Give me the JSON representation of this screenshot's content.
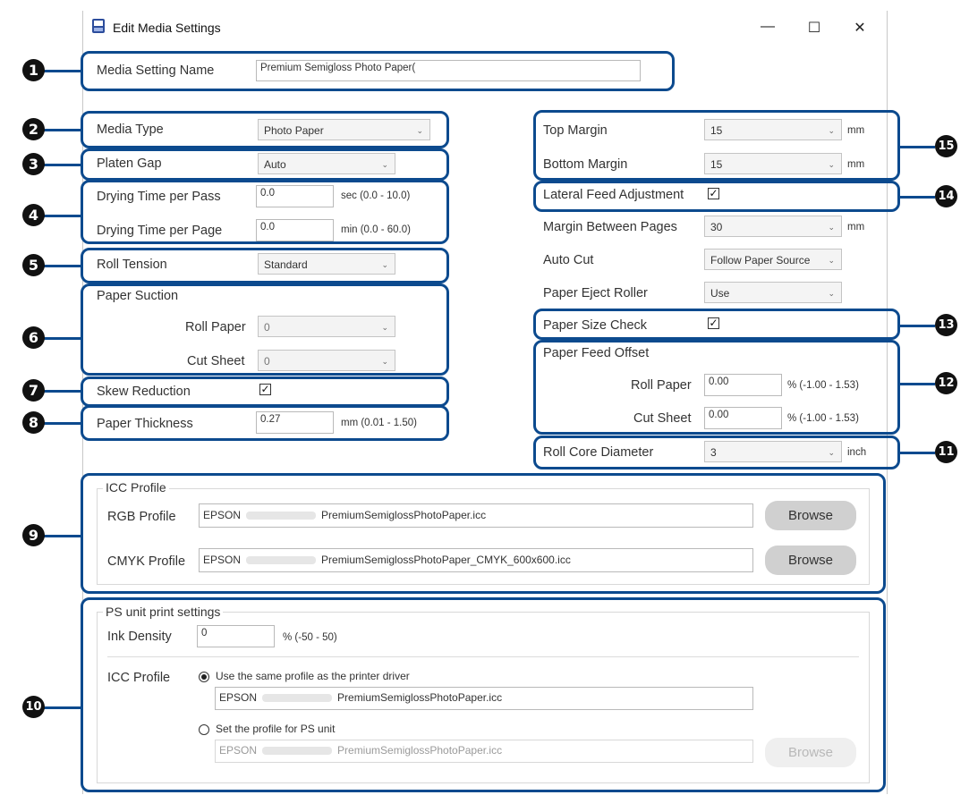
{
  "window": {
    "title": "Edit Media Settings",
    "minimize": "—",
    "maximize": "☐",
    "close": "✕"
  },
  "media_setting_name": {
    "label": "Media Setting Name",
    "value": "Premium Semigloss Photo Paper("
  },
  "media_type": {
    "label": "Media Type",
    "value": "Photo Paper"
  },
  "platen_gap": {
    "label": "Platen Gap",
    "value": "Auto"
  },
  "drying_pass": {
    "label": "Drying Time per Pass",
    "value": "0.0",
    "range": "sec (0.0 - 10.0)"
  },
  "drying_page": {
    "label": "Drying Time per Page",
    "value": "0.0",
    "range": "min (0.0 - 60.0)"
  },
  "roll_tension": {
    "label": "Roll Tension",
    "value": "Standard"
  },
  "paper_suction": {
    "title": "Paper Suction",
    "roll_label": "Roll Paper",
    "roll_value": "0",
    "cut_label": "Cut Sheet",
    "cut_value": "0"
  },
  "skew_reduction": {
    "label": "Skew Reduction",
    "checked": true
  },
  "paper_thickness": {
    "label": "Paper Thickness",
    "value": "0.27",
    "range": "mm (0.01 - 1.50)"
  },
  "top_margin": {
    "label": "Top Margin",
    "value": "15",
    "unit": "mm"
  },
  "bottom_margin": {
    "label": "Bottom Margin",
    "value": "15",
    "unit": "mm"
  },
  "lateral_feed": {
    "label": "Lateral Feed Adjustment",
    "checked": true
  },
  "margin_between": {
    "label": "Margin Between Pages",
    "value": "30",
    "unit": "mm"
  },
  "auto_cut": {
    "label": "Auto Cut",
    "value": "Follow Paper Source"
  },
  "eject_roller": {
    "label": "Paper Eject Roller",
    "value": "Use"
  },
  "paper_size_check": {
    "label": "Paper Size Check",
    "checked": true
  },
  "feed_offset": {
    "title": "Paper Feed Offset",
    "roll_label": "Roll Paper",
    "roll_value": "0.00",
    "roll_range": "% (-1.00 - 1.53)",
    "cut_label": "Cut Sheet",
    "cut_value": "0.00",
    "cut_range": "% (-1.00 - 1.53)"
  },
  "roll_core": {
    "label": "Roll Core Diameter",
    "value": "3",
    "unit": "inch"
  },
  "icc": {
    "title": "ICC Profile",
    "rgb_label": "RGB Profile",
    "rgb_prefix": "EPSON",
    "rgb_file": "PremiumSemiglossPhotoPaper.icc",
    "cmyk_label": "CMYK Profile",
    "cmyk_prefix": "EPSON",
    "cmyk_file": "PremiumSemiglossPhotoPaper_CMYK_600x600.icc",
    "browse": "Browse"
  },
  "ps": {
    "title": "PS unit print settings",
    "ink_label": "Ink Density",
    "ink_value": "0",
    "ink_range": "% (-50 - 50)",
    "icc_label": "ICC Profile",
    "opt_same": "Use the same profile as the printer driver",
    "same_prefix": "EPSON",
    "same_file": "PremiumSemiglossPhotoPaper.icc",
    "opt_set": "Set the profile for PS unit",
    "set_prefix": "EPSON",
    "set_file": "PremiumSemiglossPhotoPaper.icc",
    "browse": "Browse",
    "selected": "same"
  },
  "callouts": {
    "n1": "1",
    "n2": "2",
    "n3": "3",
    "n4": "4",
    "n5": "5",
    "n6": "6",
    "n7": "7",
    "n8": "8",
    "n9": "9",
    "n10": "10",
    "n11": "11",
    "n12": "12",
    "n13": "13",
    "n14": "14",
    "n15": "15"
  },
  "colors": {
    "callout": "#0c4a8e",
    "marker": "#111111"
  },
  "icons": {
    "chevron": "chevron-down-icon",
    "check": "check-icon",
    "app": "printer-app-icon"
  }
}
